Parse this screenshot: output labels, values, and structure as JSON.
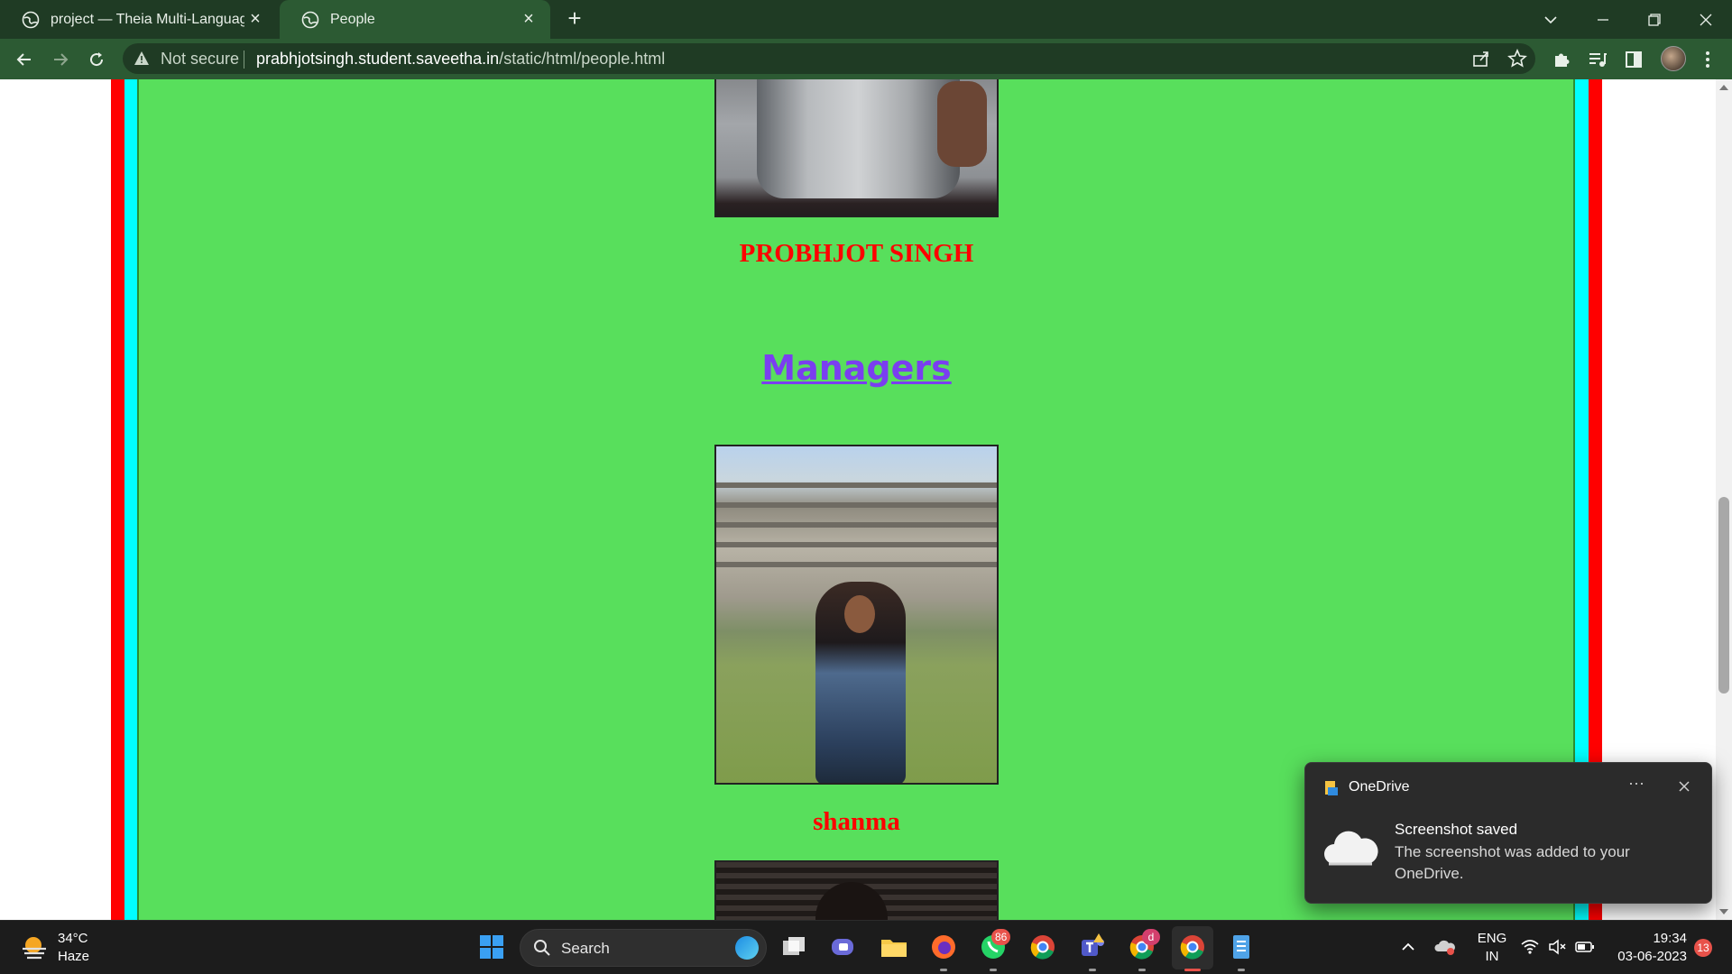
{
  "browser": {
    "tabs": [
      {
        "title": "project — Theia Multi-Language",
        "active": false
      },
      {
        "title": "People",
        "active": true
      }
    ],
    "address": {
      "security_label": "Not secure",
      "url_host": "prabhjotsingh.student.saveetha.in",
      "url_path": "/static/html/people.html"
    }
  },
  "page": {
    "person1_name": "PROBHJOT SINGH",
    "section_heading": "Managers",
    "person2_name": "shanma",
    "colors": {
      "background": "#58df5c",
      "name": "#ff0000",
      "heading": "#7a3ef0",
      "border_red": "#ff0000",
      "border_cyan": "#00ffff"
    }
  },
  "toast": {
    "app_name": "OneDrive",
    "more_label": "···",
    "title": "Screenshot saved",
    "body": "The screenshot was added to your OneDrive."
  },
  "taskbar": {
    "weather_temp": "34°C",
    "weather_desc": "Haze",
    "search_label": "Search",
    "whatsapp_badge": "86",
    "chrome_profile_badge": "d",
    "language_top": "ENG",
    "language_bottom": "IN",
    "time": "19:34",
    "date": "03-06-2023",
    "notification_count": "13"
  }
}
